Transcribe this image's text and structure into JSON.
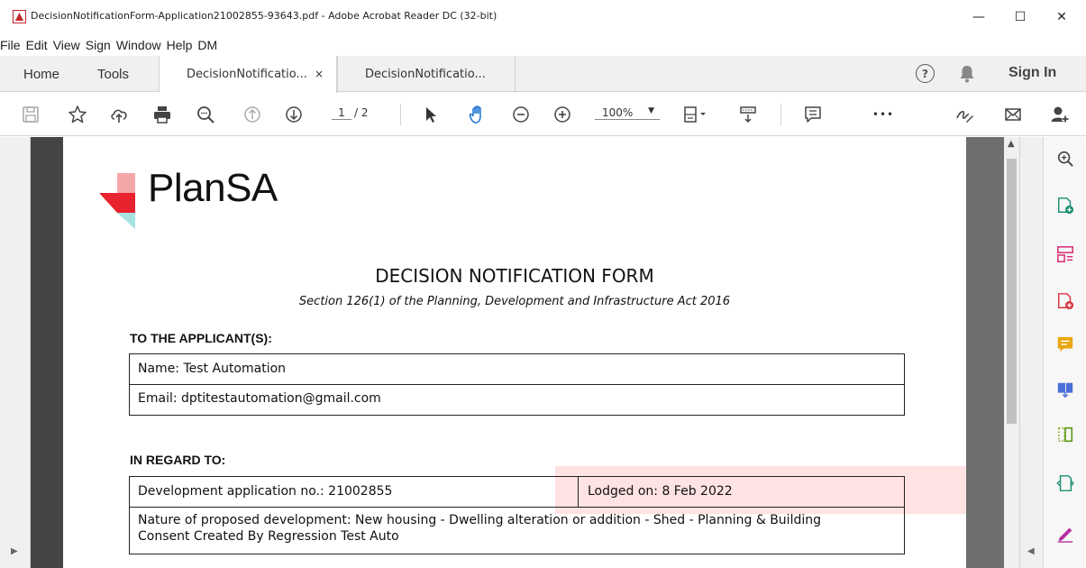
{
  "window": {
    "title": "DecisionNotificationForm-Application21002855-93643.pdf - Adobe Acrobat Reader DC (32-bit)",
    "minimize": "—",
    "maximize": "☐",
    "close": "✕"
  },
  "menu": [
    "File",
    "Edit",
    "View",
    "Sign",
    "Window",
    "Help",
    "DM"
  ],
  "tabs": {
    "home": "Home",
    "tools": "Tools",
    "doc1": "DecisionNotificatio...",
    "doc1_close": "×",
    "doc2": "DecisionNotificatio...",
    "help": "?",
    "sign_in": "Sign In"
  },
  "toolbar": {
    "page_current": "1",
    "page_total": "/ 2",
    "zoom": "100%",
    "more": "•••"
  },
  "colors": {
    "accent_red": "#c4262e",
    "logo_red": "#e8232f",
    "logo_pink": "#f4a6a9",
    "logo_teal": "#a7e3e3",
    "highlight": "#ffbebe"
  },
  "document": {
    "logo_text": "PlanSA",
    "title": "DECISION NOTIFICATION FORM",
    "subtitle": "Section 126(1) of the Planning, Development and Infrastructure Act 2016",
    "applicant_heading": "TO THE APPLICANT(S):",
    "applicant_name": "Name: Test Automation",
    "applicant_email": "Email: dptitestautomation@gmail.com",
    "regard_heading": "IN REGARD TO:",
    "application_no": "Development application no.: 21002855",
    "lodged_on": "Lodged on: 8 Feb 2022",
    "nature_line1": "Nature of proposed development: New housing - Dwelling alteration or addition - Shed - Planning & Building",
    "nature_line2": "Consent Created By Regression Test Auto"
  }
}
